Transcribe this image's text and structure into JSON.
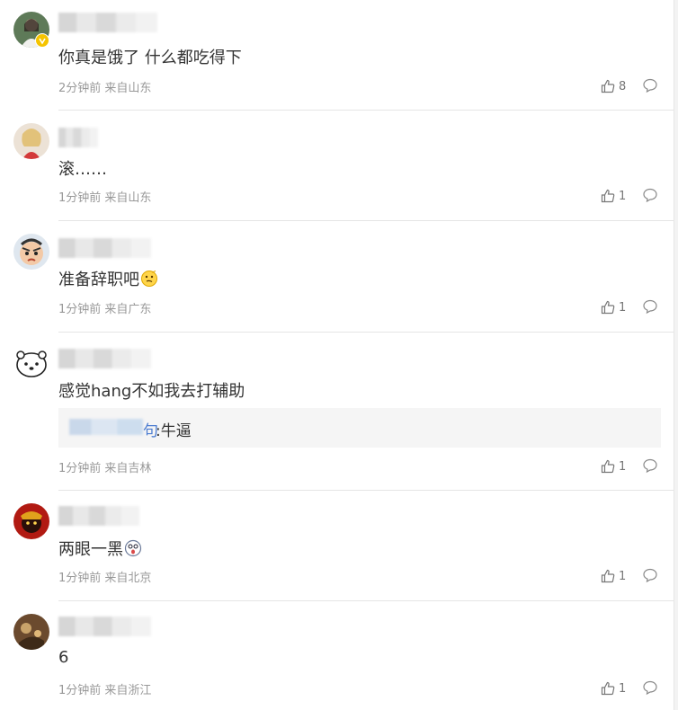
{
  "comments": [
    {
      "text": "你真是饿了 什么都吃得下",
      "time": "2分钟前",
      "location": "来自山东",
      "likes": "8",
      "emoji": null,
      "verified": true
    },
    {
      "text": "滚……",
      "time": "1分钟前",
      "location": "来自山东",
      "likes": "1",
      "emoji": null,
      "verified": false
    },
    {
      "text": "准备辞职吧",
      "time": "1分钟前",
      "location": "来自广东",
      "likes": "1",
      "emoji": "thinking-emoji",
      "verified": false
    },
    {
      "text": "感觉hang不如我去打辅助",
      "time": "1分钟前",
      "location": "来自吉林",
      "likes": "1",
      "emoji": null,
      "verified": false,
      "reply": {
        "name_suffix": "句",
        "text": ":牛逼"
      }
    },
    {
      "text": "两眼一黑",
      "time": "1分钟前",
      "location": "来自北京",
      "likes": "1",
      "emoji": "dizzy-emoji",
      "verified": false
    },
    {
      "text": "6",
      "time": "1分钟前",
      "location": "来自浙江",
      "likes": "1",
      "emoji": null,
      "verified": false
    }
  ],
  "colors": {
    "text": "#333333",
    "meta": "#999999",
    "divider": "#e5e5e5",
    "reply_bg": "#f5f5f5",
    "reply_name": "#4a7bd0",
    "verified_badge": "#f5c400"
  }
}
